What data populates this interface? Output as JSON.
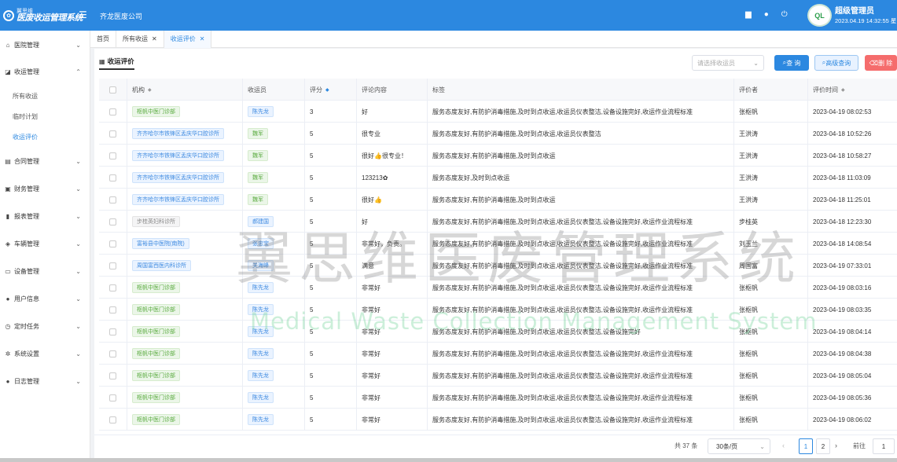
{
  "brand": {
    "line1": "翼思维",
    "line2": "医废收运管理系统"
  },
  "company": "齐龙医废公司",
  "user": {
    "avatar_text": "QL",
    "name": "超级管理员",
    "time": "2023.04.19 14:32:55 星"
  },
  "sidebar": {
    "items": [
      {
        "label": "医院管理",
        "icon": "home-icon"
      },
      {
        "label": "收运管理",
        "icon": "truck-icon"
      },
      {
        "label": "合同管理",
        "icon": "contract-icon"
      },
      {
        "label": "财务管理",
        "icon": "finance-icon"
      },
      {
        "label": "报表管理",
        "icon": "chart-icon"
      },
      {
        "label": "车辆管理",
        "icon": "car-icon"
      },
      {
        "label": "设备管理",
        "icon": "monitor-icon"
      },
      {
        "label": "用户信息",
        "icon": "user-icon"
      },
      {
        "label": "定时任务",
        "icon": "clock-icon"
      },
      {
        "label": "系统设置",
        "icon": "gear-icon"
      },
      {
        "label": "日志管理",
        "icon": "info-icon"
      }
    ],
    "subitems": [
      "所有收运",
      "临时计划",
      "收运评价"
    ]
  },
  "tabs": [
    {
      "label": "首页"
    },
    {
      "label": "所有收运"
    },
    {
      "label": "收运评价"
    }
  ],
  "page": {
    "title": "收运评价",
    "select_placeholder": "请选择收运员",
    "btn_query": "查 询",
    "btn_advanced": "高级查询",
    "btn_delete": "删 除"
  },
  "table": {
    "headers": [
      "机构",
      "收运员",
      "评分",
      "评论内容",
      "标签",
      "评价者",
      "评价时间"
    ],
    "rows": [
      {
        "org": "枢帆中医门诊部",
        "org_style": "green",
        "collector": "陈先龙",
        "collector_style": "blue",
        "score": "3",
        "comment": "好",
        "tags": "服务态度友好,有防护消毒措施,及时到点收运,收运员仪表整洁,设备设施完好,收运作业流程标准",
        "evaluator": "张枢帆",
        "time": "2023-04-19 08:02:53"
      },
      {
        "org": "齐齐哈尔市铁锋区孟庆华口腔诊所",
        "org_style": "blue",
        "collector": "魏军",
        "collector_style": "green",
        "score": "5",
        "comment": "很专业",
        "tags": "服务态度友好,有防护消毒措施,及时到点收运,收运员仪表整洁",
        "evaluator": "王洪涛",
        "time": "2023-04-18 10:52:26"
      },
      {
        "org": "齐齐哈尔市铁锋区孟庆华口腔诊所",
        "org_style": "blue",
        "collector": "魏军",
        "collector_style": "green",
        "score": "5",
        "comment": "很好👍很专业！",
        "tags": "服务态度友好,有防护消毒措施,及时到点收运",
        "evaluator": "王洪涛",
        "time": "2023-04-18 10:58:27"
      },
      {
        "org": "齐齐哈尔市铁锋区孟庆华口腔诊所",
        "org_style": "blue",
        "collector": "魏军",
        "collector_style": "green",
        "score": "5",
        "comment": "123213✿",
        "tags": "服务态度友好,及时到点收运",
        "evaluator": "王洪涛",
        "time": "2023-04-18 11:03:09"
      },
      {
        "org": "齐齐哈尔市铁锋区孟庆华口腔诊所",
        "org_style": "blue",
        "collector": "魏军",
        "collector_style": "green",
        "score": "5",
        "comment": "很好👍",
        "tags": "服务态度友好,有防护消毒措施,及时到点收运",
        "evaluator": "王洪涛",
        "time": "2023-04-18 11:25:01"
      },
      {
        "org": "步桂英妇科诊所",
        "org_style": "gray",
        "collector": "郝建国",
        "collector_style": "blue",
        "score": "5",
        "comment": "好",
        "tags": "服务态度友好,有防护消毒措施,及时到点收运,收运员仪表整洁,设备设施完好,收运作业流程标准",
        "evaluator": "步桂英",
        "time": "2023-04-18 12:23:30"
      },
      {
        "org": "富裕县中医院(南院)",
        "org_style": "blue",
        "collector": "张忠宝",
        "collector_style": "blue",
        "score": "5",
        "comment": "非常好，负责。",
        "tags": "服务态度友好,有防护消毒措施,及时到点收运,收运员仪表整洁,设备设施完好,收运作业流程标准",
        "evaluator": "刘玉兰",
        "time": "2023-04-18 14:08:54"
      },
      {
        "org": "周国富西医内科诊所",
        "org_style": "blue",
        "collector": "关海峰",
        "collector_style": "blue",
        "score": "5",
        "comment": "满意",
        "tags": "服务态度友好,有防护消毒措施,及时到点收运,收运员仪表整洁,设备设施完好,收运作业流程标准",
        "evaluator": "周国富",
        "time": "2023-04-19 07:33:01"
      },
      {
        "org": "枢帆中医门诊部",
        "org_style": "green",
        "collector": "陈先龙",
        "collector_style": "blue",
        "score": "5",
        "comment": "非常好",
        "tags": "服务态度友好,有防护消毒措施,及时到点收运,收运员仪表整洁,设备设施完好,收运作业流程标准",
        "evaluator": "张枢帆",
        "time": "2023-04-19 08:03:16"
      },
      {
        "org": "枢帆中医门诊部",
        "org_style": "green",
        "collector": "陈先龙",
        "collector_style": "blue",
        "score": "5",
        "comment": "非常好",
        "tags": "服务态度友好,有防护消毒措施,及时到点收运,收运员仪表整洁,设备设施完好,收运作业流程标准",
        "evaluator": "张枢帆",
        "time": "2023-04-19 08:03:35"
      },
      {
        "org": "枢帆中医门诊部",
        "org_style": "green",
        "collector": "陈先龙",
        "collector_style": "blue",
        "score": "5",
        "comment": "非常好",
        "tags": "服务态度友好,有防护消毒措施,及时到点收运,收运员仪表整洁,设备设施完好",
        "evaluator": "张枢帆",
        "time": "2023-04-19 08:04:14"
      },
      {
        "org": "枢帆中医门诊部",
        "org_style": "green",
        "collector": "陈先龙",
        "collector_style": "blue",
        "score": "5",
        "comment": "非常好",
        "tags": "服务态度友好,有防护消毒措施,及时到点收运,收运员仪表整洁,设备设施完好,收运作业流程标准",
        "evaluator": "张枢帆",
        "time": "2023-04-19 08:04:38"
      },
      {
        "org": "枢帆中医门诊部",
        "org_style": "green",
        "collector": "陈先龙",
        "collector_style": "blue",
        "score": "5",
        "comment": "非常好",
        "tags": "服务态度友好,有防护消毒措施,及时到点收运,收运员仪表整洁,设备设施完好,收运作业流程标准",
        "evaluator": "张枢帆",
        "time": "2023-04-19 08:05:04"
      },
      {
        "org": "枢帆中医门诊部",
        "org_style": "green",
        "collector": "陈先龙",
        "collector_style": "blue",
        "score": "5",
        "comment": "非常好",
        "tags": "服务态度友好,有防护消毒措施,及时到点收运,收运员仪表整洁,设备设施完好,收运作业流程标准",
        "evaluator": "张枢帆",
        "time": "2023-04-19 08:05:36"
      },
      {
        "org": "枢帆中医门诊部",
        "org_style": "green",
        "collector": "陈先龙",
        "collector_style": "blue",
        "score": "5",
        "comment": "非常好",
        "tags": "服务态度友好,有防护消毒措施,及时到点收运,收运员仪表整洁,设备设施完好,收运作业流程标准",
        "evaluator": "张枢帆",
        "time": "2023-04-19 08:06:02"
      }
    ]
  },
  "pagination": {
    "total": "共 37 条",
    "page_size": "30条/页",
    "pages": [
      "1",
      "2"
    ],
    "current": "1",
    "goto_label": "前往",
    "goto_value": "1"
  },
  "watermark": {
    "main": "翼思维医废管理系统",
    "sub": "Medical Waste Collection Management System"
  }
}
